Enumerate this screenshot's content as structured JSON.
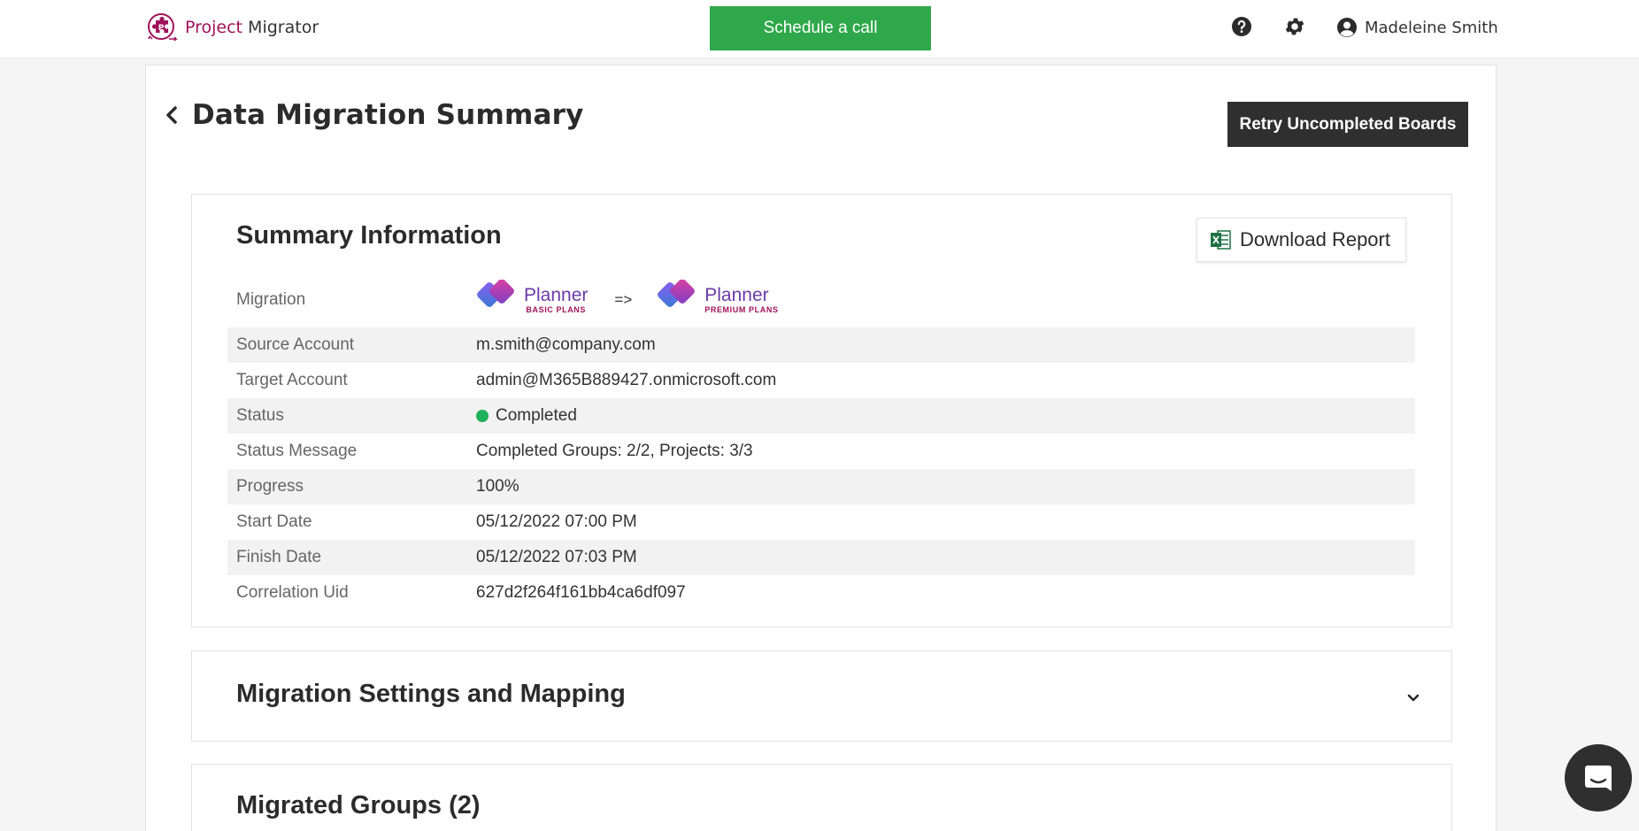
{
  "header": {
    "brand_accent": "Project",
    "brand_rest": " Migrator",
    "schedule_label": "Schedule a call",
    "user_name": "Madeleine Smith"
  },
  "page": {
    "title": "Data Migration Summary",
    "retry_label": "Retry Uncompleted Boards"
  },
  "summary": {
    "title": "Summary Information",
    "download_label": "Download Report",
    "migration": {
      "label": "Migration",
      "source": {
        "name": "Planner",
        "sub": "BASIC PLANS"
      },
      "arrow": "=>",
      "target": {
        "name": "Planner",
        "sub": "PREMIUM PLANS"
      }
    },
    "rows": [
      {
        "label": "Source Account",
        "value": "m.smith@company.com"
      },
      {
        "label": "Target Account",
        "value": "admin@M365B889427.onmicrosoft.com"
      },
      {
        "label": "Status",
        "value": "Completed"
      },
      {
        "label": "Status Message",
        "value": "Completed Groups: 2/2, Projects: 3/3"
      },
      {
        "label": "Progress",
        "value": "100%"
      },
      {
        "label": "Start Date",
        "value": "05/12/2022 07:00 PM"
      },
      {
        "label": "Finish Date",
        "value": "05/12/2022 07:03 PM"
      },
      {
        "label": "Correlation Uid",
        "value": "627d2f264f161bb4ca6df097"
      }
    ]
  },
  "settings": {
    "title": "Migration Settings and Mapping"
  },
  "groups": {
    "title": "Migrated Groups (2)"
  },
  "colors": {
    "brand": "#a0125a",
    "schedule_green": "#2ea84a",
    "status_green": "#1fb05a",
    "dark_button": "#2f2f2f",
    "planner_purple": "#6a3aa8"
  },
  "icons": [
    "puzzle-logo-icon",
    "help-icon",
    "gear-icon",
    "user-circle-icon",
    "chevron-left-icon",
    "excel-icon",
    "planner-logo-icon",
    "chevron-down-icon",
    "chat-icon"
  ]
}
